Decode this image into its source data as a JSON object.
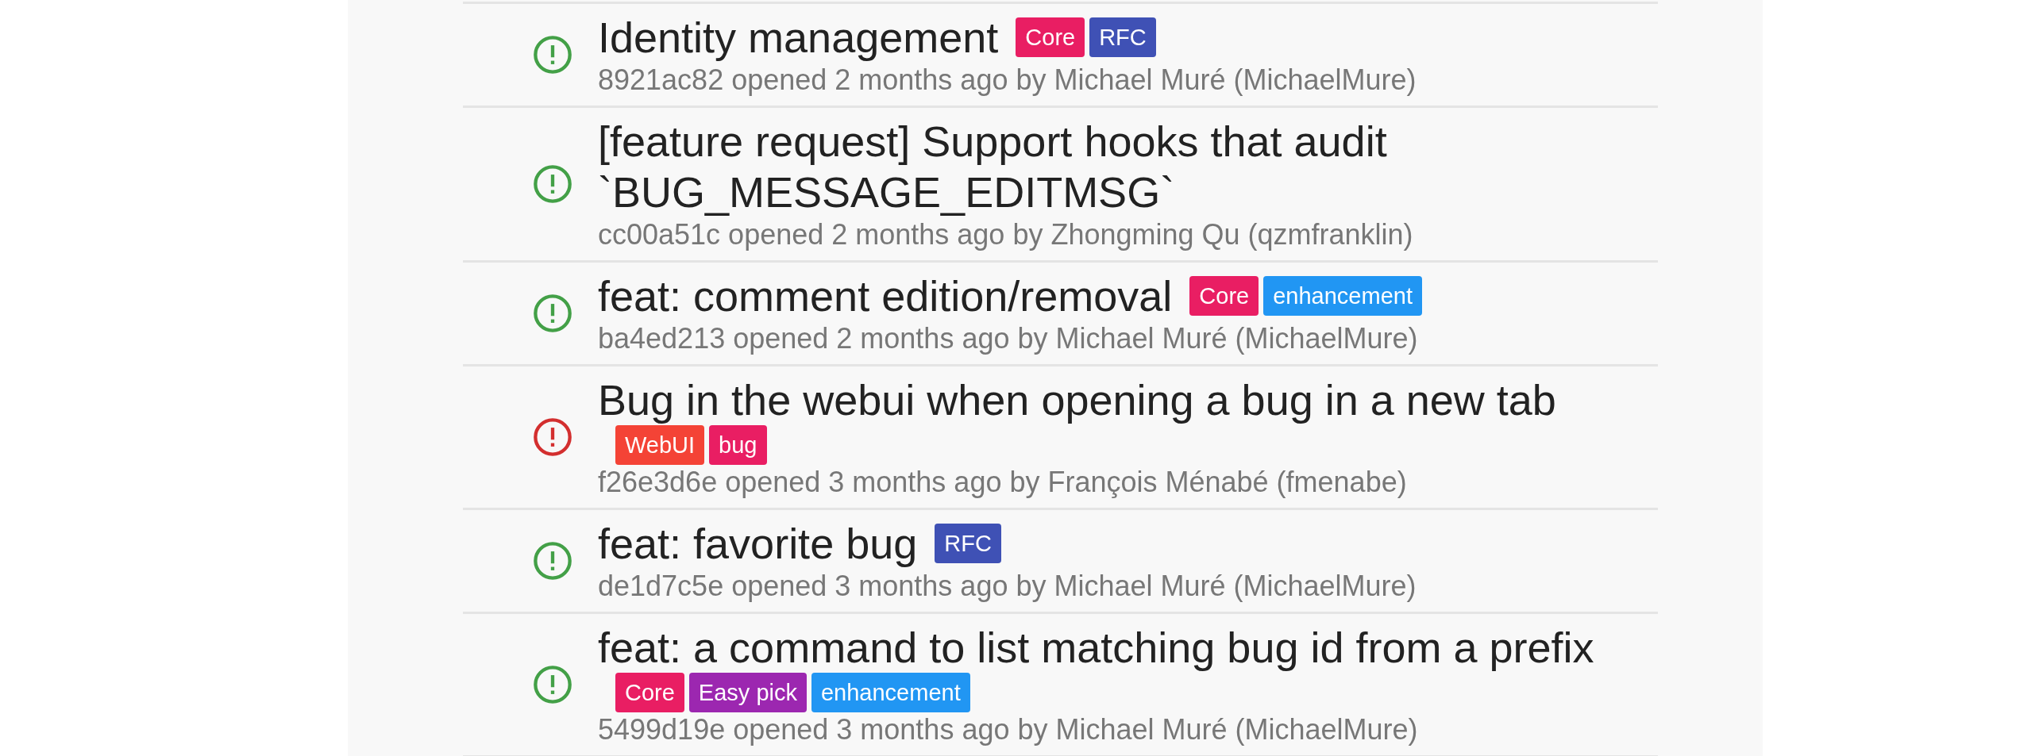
{
  "issues": [
    {
      "kind": "open",
      "title": "Identity management",
      "labels": [
        {
          "text": "Core",
          "color": "#e91e63"
        },
        {
          "text": "RFC",
          "color": "#3f51b5"
        }
      ],
      "meta": "8921ac82 opened 2 months ago by Michael Muré (MichaelMure)"
    },
    {
      "kind": "open",
      "title": "[feature request] Support hooks that audit `BUG_MESSAGE_EDITMSG`",
      "meta": "cc00a51c opened 2 months ago by Zhongming Qu (qzmfranklin)"
    },
    {
      "kind": "open",
      "title": "feat: comment edition/removal",
      "labels": [
        {
          "text": "Core",
          "color": "#e91e63"
        },
        {
          "text": "enhancement",
          "color": "#2196f3"
        }
      ],
      "meta": "ba4ed213 opened 2 months ago by Michael Muré (MichaelMure)"
    },
    {
      "kind": "closed",
      "title": "Bug in the webui when opening a bug in a new tab",
      "labels": [
        {
          "text": "WebUI",
          "color": "#f44336"
        },
        {
          "text": "bug",
          "color": "#e91e63"
        }
      ],
      "meta": "f26e3d6e opened 3 months ago by François Ménabé (fmenabe)"
    },
    {
      "kind": "open",
      "title": "feat: favorite bug",
      "labels": [
        {
          "text": "RFC",
          "color": "#3f51b5"
        }
      ],
      "meta": "de1d7c5e opened 3 months ago by Michael Muré (MichaelMure)"
    },
    {
      "kind": "open",
      "title": "feat: a command to list matching bug id from a prefix",
      "labels": [
        {
          "text": "Core",
          "color": "#e91e63"
        },
        {
          "text": "Easy pick",
          "color": "#9c27b0"
        },
        {
          "text": "enhancement",
          "color": "#2196f3"
        }
      ],
      "meta": "5499d19e opened 3 months ago by Michael Muré (MichaelMure)"
    }
  ]
}
